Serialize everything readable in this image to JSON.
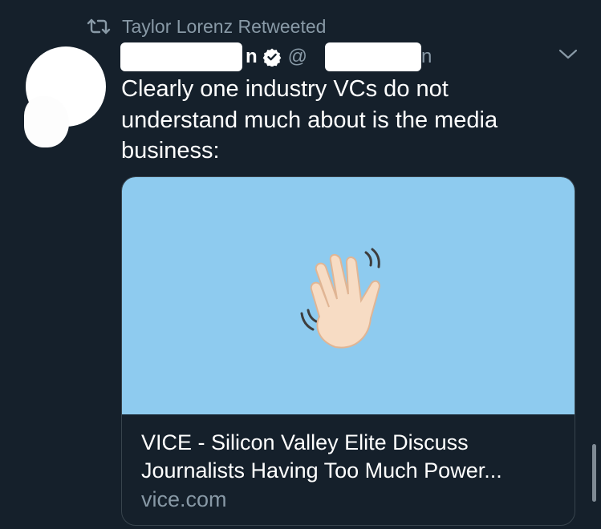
{
  "retweet": {
    "icon": "retweet-icon",
    "text": "Taylor Lorenz Retweeted"
  },
  "author": {
    "name_tail": "n",
    "verified_icon": "verified-badge-icon",
    "handle_prefix": "@",
    "handle_tail": "n"
  },
  "menu": {
    "icon": "chevron-down-icon"
  },
  "tweet": {
    "text": "Clearly one industry VCs do not\nunderstand much about is the media\nbusiness:"
  },
  "card": {
    "image_icon": "waving-hand-icon",
    "image_bg": "#8ecbef",
    "title": "VICE - Silicon Valley Elite Discuss\nJournalists Having Too Much Power...",
    "domain": "vice.com"
  },
  "colors": {
    "background": "#15202b",
    "secondary_text": "#8899a6",
    "border": "#38444d"
  }
}
